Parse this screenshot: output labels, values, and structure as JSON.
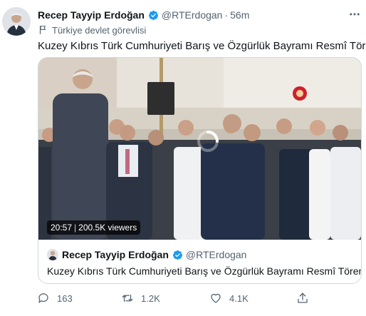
{
  "tweet": {
    "author_name": "Recep Tayyip Erdoğan",
    "handle": "@RTErdogan",
    "separator": "·",
    "time": "56m",
    "label": "Türkiye devlet görevlisi",
    "text": "Kuzey Kıbrıs Türk Cumhuriyeti Barış ve Özgürlük Bayramı Resmî Töreni"
  },
  "quote": {
    "author_name": "Recep Tayyip Erdoğan",
    "handle": "@RTErdogan",
    "text": "Kuzey Kıbrıs Türk Cumhuriyeti Barış ve Özgürlük Bayramı Resmî Töreni",
    "video": {
      "duration": "20:57",
      "separator": "|",
      "viewers": "200.5K viewers"
    }
  },
  "actions": {
    "replies": "163",
    "retweets": "1.2K",
    "likes": "4.1K"
  },
  "colors": {
    "verified": "#1d9bf0",
    "secondary_text": "#536471",
    "border": "#cfd9de"
  },
  "icons": [
    "more-icon",
    "verified-badge-icon",
    "flag-icon",
    "loading-spinner-icon",
    "reply-icon",
    "retweet-icon",
    "like-icon",
    "share-icon"
  ]
}
